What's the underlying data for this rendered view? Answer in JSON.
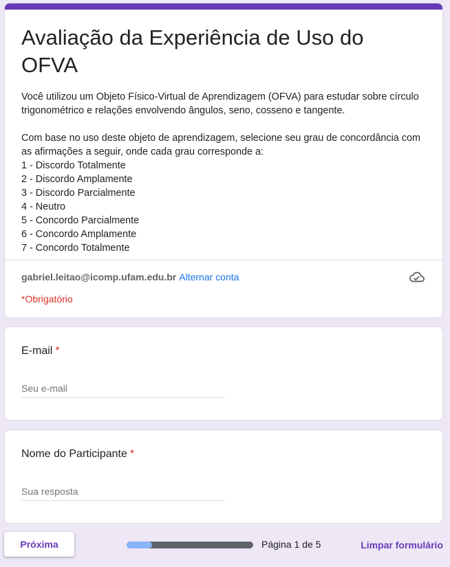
{
  "form": {
    "title": "Avaliação da Experiência de Uso do OFVA",
    "description": "Você utilizou um Objeto Físico-Virtual de Aprendizagem (OFVA) para estudar sobre círculo trigonométrico e relações envolvendo ângulos, seno, cosseno e tangente.\n\nCom base no uso deste objeto de aprendizagem, selecione seu grau de concordância com as afirmações a seguir, onde cada grau corresponde a:\n1 - Discordo Totalmente\n2 - Discordo Amplamente\n3 - Discordo Parcialmente\n4 - Neutro\n5 - Concordo Parcialmente\n6 - Concordo Amplamente\n7 - Concordo Totalmente",
    "account_email": "gabriel.leitao@icomp.ufam.edu.br",
    "switch_account_label": "Alternar conta",
    "cloud_icon": "cloud-saved-icon",
    "required_note": "*Obrigatório"
  },
  "questions": [
    {
      "label": "E-mail",
      "required_mark": "*",
      "placeholder": "Seu e-mail",
      "value": ""
    },
    {
      "label": "Nome do Participante",
      "required_mark": "*",
      "placeholder": "Sua resposta",
      "value": ""
    }
  ],
  "footer": {
    "next_label": "Próxima",
    "progress_fraction": 0.2,
    "page_indicator": "Página 1 de 5",
    "clear_label": "Limpar formulário"
  },
  "colors": {
    "accent": "#673ab7",
    "background": "#ede7f6",
    "required": "#d93025",
    "link": "#1a73e8",
    "progress_fill": "#8ab4f8",
    "progress_track": "#5f6368"
  }
}
